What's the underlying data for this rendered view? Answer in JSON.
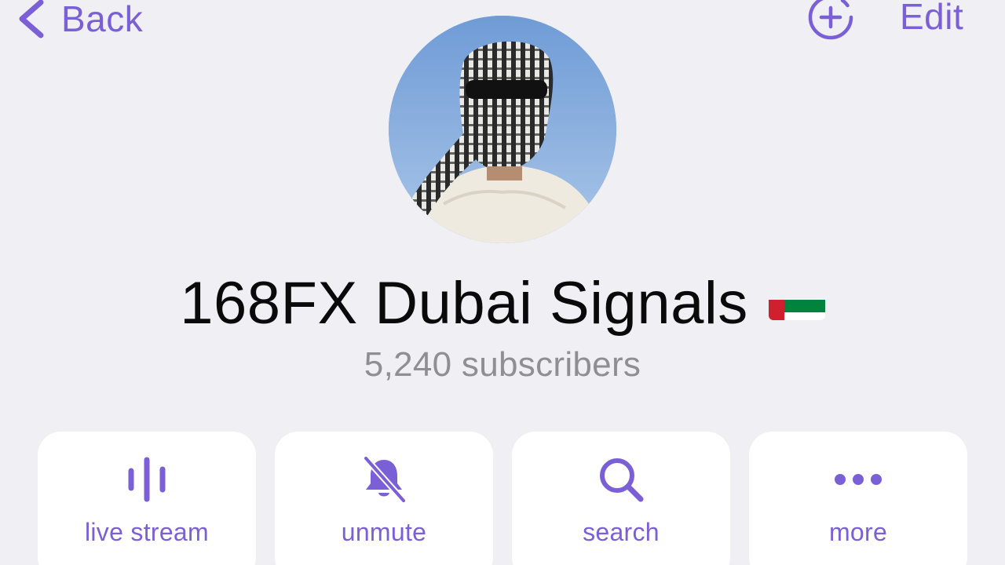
{
  "nav": {
    "back_label": "Back",
    "edit_label": "Edit"
  },
  "channel": {
    "name": "168FX Dubai Signals",
    "subscribers": "5,240 subscribers"
  },
  "actions": [
    {
      "label": "live stream",
      "icon": "live-stream-icon"
    },
    {
      "label": "unmute",
      "icon": "muted-bell-icon"
    },
    {
      "label": "search",
      "icon": "search-icon"
    },
    {
      "label": "more",
      "icon": "more-icon"
    }
  ],
  "colors": {
    "accent": "#7b5fd6",
    "background": "#efeff4",
    "secondary_text": "#8e8e93"
  }
}
